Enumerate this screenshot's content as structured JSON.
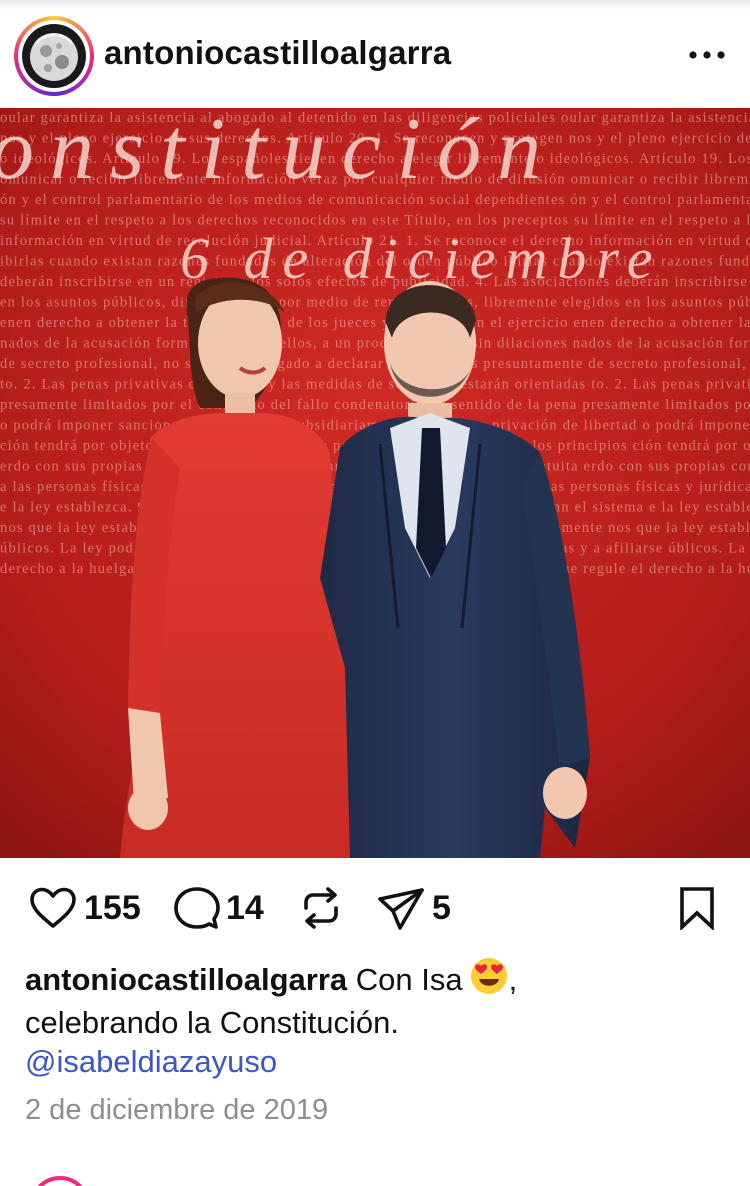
{
  "post": {
    "username": "antoniocastilloalgarra",
    "image": {
      "description_icon": "photo",
      "backdrop_title_1": "onstitución",
      "backdrop_title_2": "6 de diciembre",
      "backdrop_text_lines": [
        "oular    garantiza la asistencia al abogado al detenido en las diligencias policiales",
        "nos y el pleno ejercicio de sus derechos. Artículo 20. 1. Se reconocen y protegen",
        "o ideológicos. Artículo 19. Los españoles tienen derecho a elegir libremente",
        "omunicar o recibir libremente información veraz por cualquier medio de difusión",
        "ón y el control parlamentario de los medios de comunicación social dependientes",
        "su límite en el respeto a los derechos reconocidos en este Título, en los preceptos",
        "información en virtud de resolución judicial. Artículo 21. 1. Se reconoce el derecho",
        "ibirlas cuando existan razones fundadas de alteración del orden público",
        "deberán inscribirse en un registro a los solos efectos de publicidad. 4. Las asociaciones",
        "en los asuntos públicos, directamente o por medio de representantes, libremente elegidos",
        "enen derecho a obtener la tutela efectiva de los jueces y tribunales en el ejercicio",
        "nados de la acusación formulada contra ellos, a un proceso público sin dilaciones",
        "de secreto profesional, no se estará obligado a declarar sobre hechos presuntamente",
        "to. 2. Las penas privativas de libertad y las medidas de seguridad estarán orientadas",
        "presamente limitados por el contenido del fallo condenatorio, el sentido de la pena",
        "o podrá imponer sanciones que, directa o subsidiariamente, impliquen privación de libertad",
        "ción tendrá por objeto el pleno desarrollo de la personalidad en el respeto a los principios",
        "erdo con sus propias convicciones. 4. La enseñanza básica es obligatoria y gratuita",
        "a las personas físicas y jurídicas la libertad de creación de centros docentes",
        "e la ley establezca. 9. Los poderes públicos ayudarán a los centros que garantizan el sistema",
        "nos que la ley establezca. Artículo 28. 1. Todos tienen derecho a sindicarse libremente",
        "úblicos. La ley podrá limitar o exceptuar el ejercicio de este derecho a las Fuerzas y a afiliarse",
        "derecho a la huelga de los trabajadores para la defensa de sus intereses. La ley que regule el"
      ]
    },
    "actions": {
      "likes": "155",
      "comments": "14",
      "shares": "5"
    },
    "caption": {
      "username": "antoniocastilloalgarra",
      "text_part1": "Con Isa",
      "text_part2": ",",
      "text_line2": "celebrando la Constitución.",
      "mention": "@isabeldiazayuso",
      "emoji": "heart-eyes-emoji"
    },
    "date": "2 de diciembre de 2019"
  },
  "colors": {
    "backdrop_red": "#b81f1c",
    "mention_blue": "#3b57c4",
    "date_gray": "#8e8e8e",
    "ring_pink": "#ee2a7b"
  }
}
